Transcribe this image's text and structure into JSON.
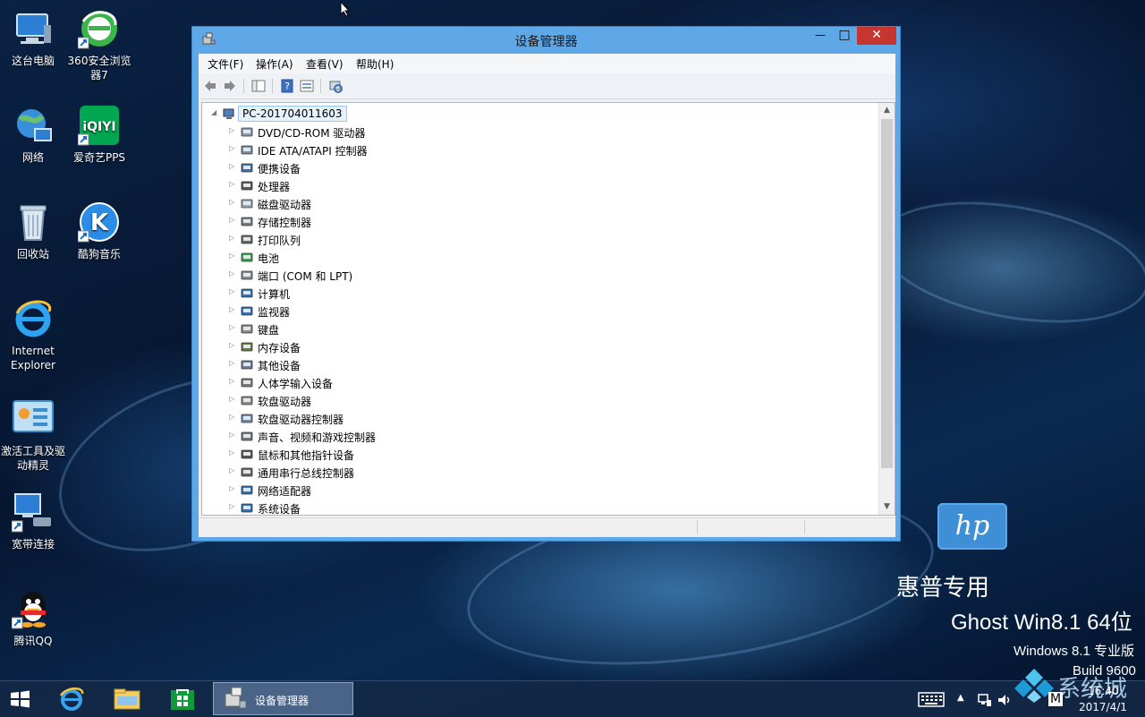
{
  "desktop": {
    "icons": [
      {
        "label": "这台电脑",
        "icon": "computer-icon"
      },
      {
        "label": "360安全浏览器7",
        "icon": "360-browser-icon"
      },
      {
        "label": "网络",
        "icon": "network-globe-icon"
      },
      {
        "label": "爱奇艺PPS",
        "icon": "iqiyi-icon"
      },
      {
        "label": "回收站",
        "icon": "recycle-bin-icon"
      },
      {
        "label": "酷狗音乐",
        "icon": "kugou-icon"
      },
      {
        "label": "Internet Explorer",
        "icon": "ie-icon"
      },
      {
        "label": "激活工具及驱动精灵",
        "icon": "activation-tool-icon"
      },
      {
        "label": "宽带连接",
        "icon": "broadband-icon"
      },
      {
        "label": "腾讯QQ",
        "icon": "qq-icon"
      }
    ],
    "brand": {
      "logo_text": "hp",
      "line1": "惠普专用",
      "line2": "Ghost Win8.1 64位",
      "line3": "Windows 8.1 专业版",
      "line4": "Build 9600",
      "watermark": "系统城"
    }
  },
  "window": {
    "title": "设备管理器",
    "controls": {
      "minimize": "—",
      "maximize": "□",
      "close": "✕"
    },
    "menu": [
      "文件(F)",
      "操作(A)",
      "查看(V)",
      "帮助(H)"
    ],
    "toolbar": [
      "back-arrow-icon",
      "forward-arrow-icon",
      "show-hide-tree-icon",
      "help-icon",
      "properties-icon",
      "scan-hardware-icon"
    ],
    "tree": {
      "root": "PC-201704011603",
      "categories": [
        "DVD/CD-ROM 驱动器",
        "IDE ATA/ATAPI 控制器",
        "便携设备",
        "处理器",
        "磁盘驱动器",
        "存储控制器",
        "打印队列",
        "电池",
        "端口 (COM 和 LPT)",
        "计算机",
        "监视器",
        "键盘",
        "内存设备",
        "其他设备",
        "人体学输入设备",
        "软盘驱动器",
        "软盘驱动器控制器",
        "声音、视频和游戏控制器",
        "鼠标和其他指针设备",
        "通用串行总线控制器",
        "网络适配器",
        "系统设备"
      ]
    }
  },
  "taskbar": {
    "task_label": "设备管理器",
    "ime": "M",
    "time": "16:40",
    "date": "2017/4/1"
  }
}
